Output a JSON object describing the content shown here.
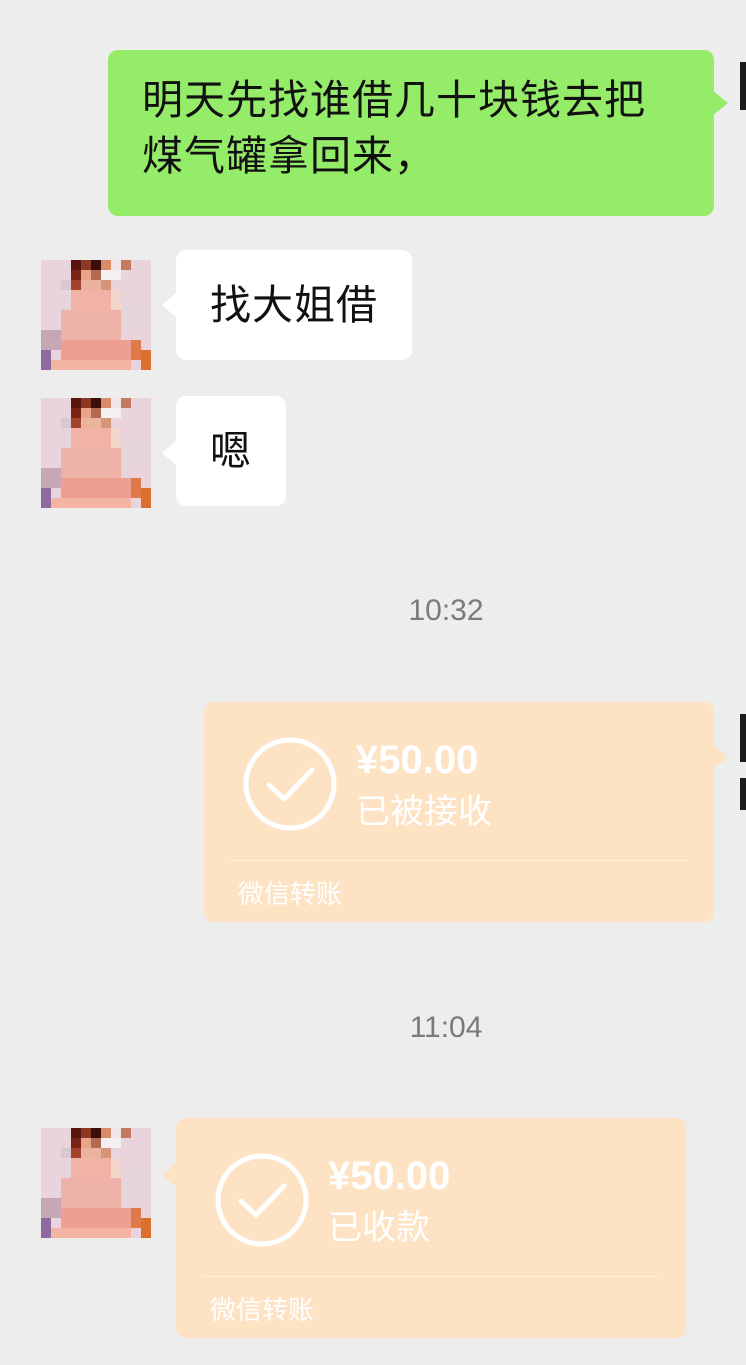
{
  "messages": {
    "sent_text": "明天先找谁借几十块钱去把\n煤气罐拿回来，",
    "received_1": "找大姐借",
    "received_2": "嗯"
  },
  "timestamps": {
    "t1": "10:32",
    "t2": "11:04"
  },
  "transfers": {
    "sent": {
      "amount": "¥50.00",
      "status": "已被接收",
      "footer": "微信转账"
    },
    "received": {
      "amount": "¥50.00",
      "status": "已收款",
      "footer": "微信转账"
    }
  },
  "colors": {
    "background": "#EDEDED",
    "sent_bubble": "#95EC69",
    "received_bubble": "#FFFFFF",
    "transfer_card": "#FDE2C4",
    "timestamp_text": "#7A7A7A"
  },
  "icons": {
    "check": "check-circle-icon"
  }
}
